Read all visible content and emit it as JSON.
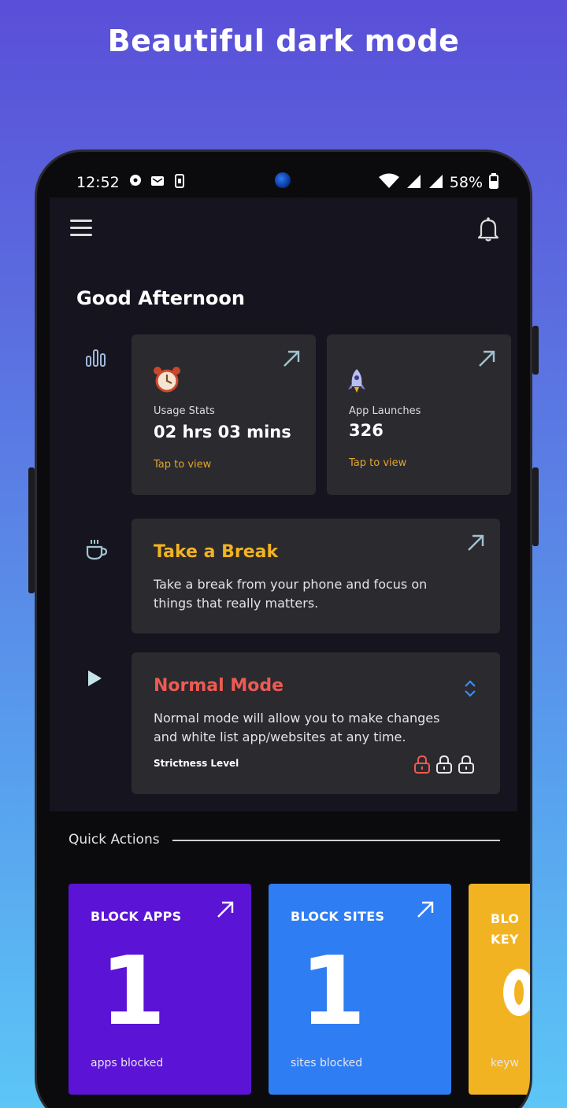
{
  "headline": "Beautiful dark mode",
  "status_bar": {
    "time": "12:52",
    "battery": "58%"
  },
  "greeting": "Good Afternoon",
  "usage_card": {
    "label": "Usage Stats",
    "value": "02 hrs 03 mins",
    "action": "Tap to view"
  },
  "launches_card": {
    "label": "App Launches",
    "value": "326",
    "action": "Tap to view"
  },
  "break_card": {
    "title": "Take a Break",
    "line1": "Take a break from your phone and focus on",
    "line2": "things that really matters."
  },
  "mode_card": {
    "title": "Normal Mode",
    "line1": "Normal mode will allow you to make changes",
    "line2": "and white list app/websites at any time.",
    "strictness_label": "Strictness Level",
    "strictness_level": 1,
    "strictness_max": 3
  },
  "quick_actions": {
    "label": "Quick Actions",
    "cards": [
      {
        "title": "BLOCK APPS",
        "count": "1",
        "subtitle": "apps blocked",
        "color": "#5b13d6"
      },
      {
        "title": "BLOCK SITES",
        "count": "1",
        "subtitle": "sites blocked",
        "color": "#2f7df2"
      },
      {
        "title_line1": "BLO",
        "title_line2": "KEY",
        "subtitle": "keyw",
        "color": "#f2b322"
      }
    ]
  },
  "colors": {
    "accent_yellow": "#f2b322",
    "mode_red": "#ee5a52",
    "card_bg": "#2b2a2f"
  }
}
